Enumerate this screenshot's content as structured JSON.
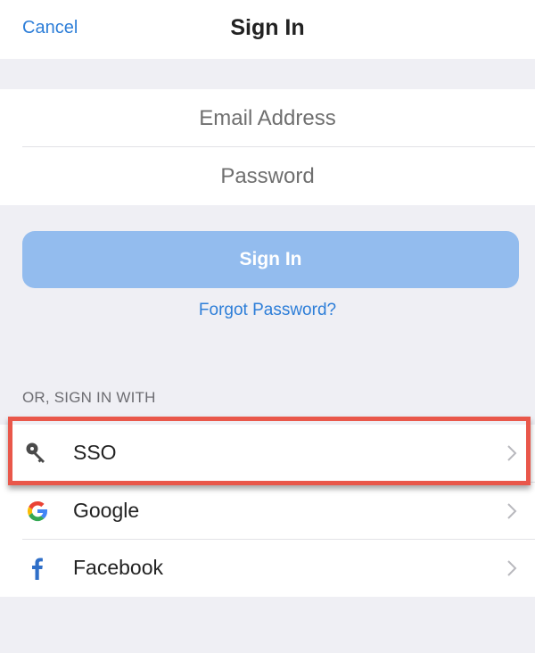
{
  "nav": {
    "cancel_label": "Cancel",
    "title": "Sign In"
  },
  "form": {
    "email": {
      "value": "",
      "placeholder": "Email Address"
    },
    "password": {
      "value": "",
      "placeholder": "Password"
    },
    "submit_label": "Sign In",
    "forgot_label": "Forgot Password?"
  },
  "alt_signin": {
    "header": "OR, SIGN IN WITH",
    "providers": [
      {
        "label": "SSO",
        "icon": "key-icon",
        "highlighted": true
      },
      {
        "label": "Google",
        "icon": "google-icon",
        "highlighted": false
      },
      {
        "label": "Facebook",
        "icon": "facebook-icon",
        "highlighted": false
      }
    ]
  },
  "colors": {
    "accent": "#2d7ed8",
    "button_disabled": "#93bcee",
    "highlight": "#e9574a",
    "background": "#efeff4"
  }
}
